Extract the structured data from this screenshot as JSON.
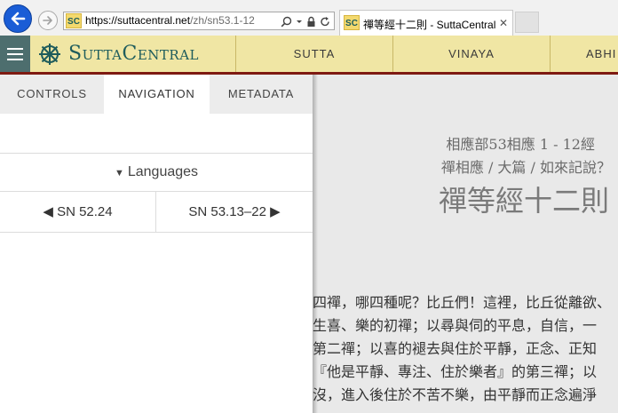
{
  "browser": {
    "url_host": "https://suttacentral.net",
    "url_path": "/zh/sn53.1-12",
    "tab_title": "禪等經十二則 - SuttaCentral",
    "tab_close": "✕",
    "favicon_text": "SC"
  },
  "site": {
    "logo_text": "SuttaCentral",
    "nav": [
      "SUTTA",
      "VINAYA",
      "ABHI"
    ]
  },
  "panel": {
    "tabs": [
      "CONTROLS",
      "NAVIGATION",
      "METADATA"
    ],
    "active_tab": "NAVIGATION",
    "languages_label": "Languages",
    "prev_label": "SN 52.24",
    "next_label": "SN 53.13–22"
  },
  "main": {
    "header_line1": "相應部53相應 1 - 12經",
    "header_line2": "禪相應 / 大篇 / 如來記說？",
    "title": "禪等經十二則",
    "body_lines": [
      "四禪，哪四種呢？比丘們！這裡，比丘從離欲、",
      "生喜、樂的初禪；以尋與伺的平息，自信，一",
      "第二禪；以喜的褪去與住於平靜，正念、正知",
      "『他是平靜、專注、住於樂者』的第三禪；以",
      "沒，進入後住於不苦不樂，由平靜而正念遍淨"
    ]
  },
  "colors": {
    "header_bg": "#f0e6a4",
    "header_border": "#7e1a12",
    "brand": "#1e5c5c",
    "hamburger_bg": "#4d6e6e",
    "back_button": "#1a5dd6"
  }
}
